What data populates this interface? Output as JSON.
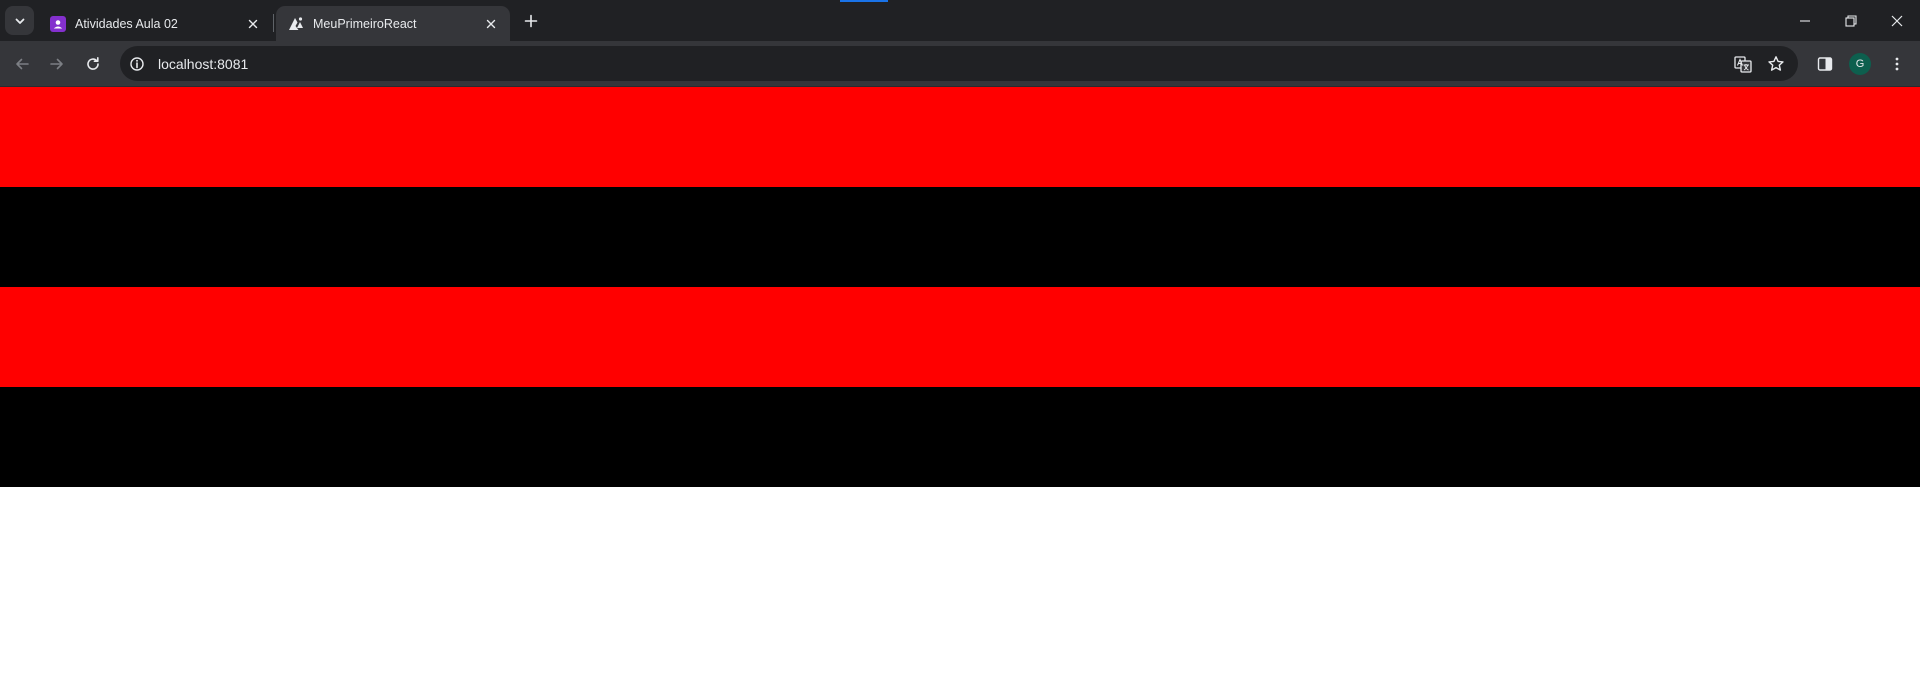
{
  "browser": {
    "tabs": [
      {
        "title": "Atividades Aula 02",
        "favicon": "classroom-icon",
        "active": false
      },
      {
        "title": "MeuPrimeiroReact",
        "favicon": "expo-icon",
        "active": true
      }
    ],
    "toolbar": {
      "url": "localhost:8081",
      "avatar_initial": "G"
    },
    "colors": {
      "frame": "#202124",
      "toolbar": "#35363a",
      "accent": "#1a73e8",
      "avatar": "#0d5f4e"
    }
  },
  "page": {
    "stripes": [
      {
        "color": "#ff0000"
      },
      {
        "color": "#000000"
      },
      {
        "color": "#ff0000"
      },
      {
        "color": "#000000"
      }
    ],
    "background": "#ffffff"
  }
}
